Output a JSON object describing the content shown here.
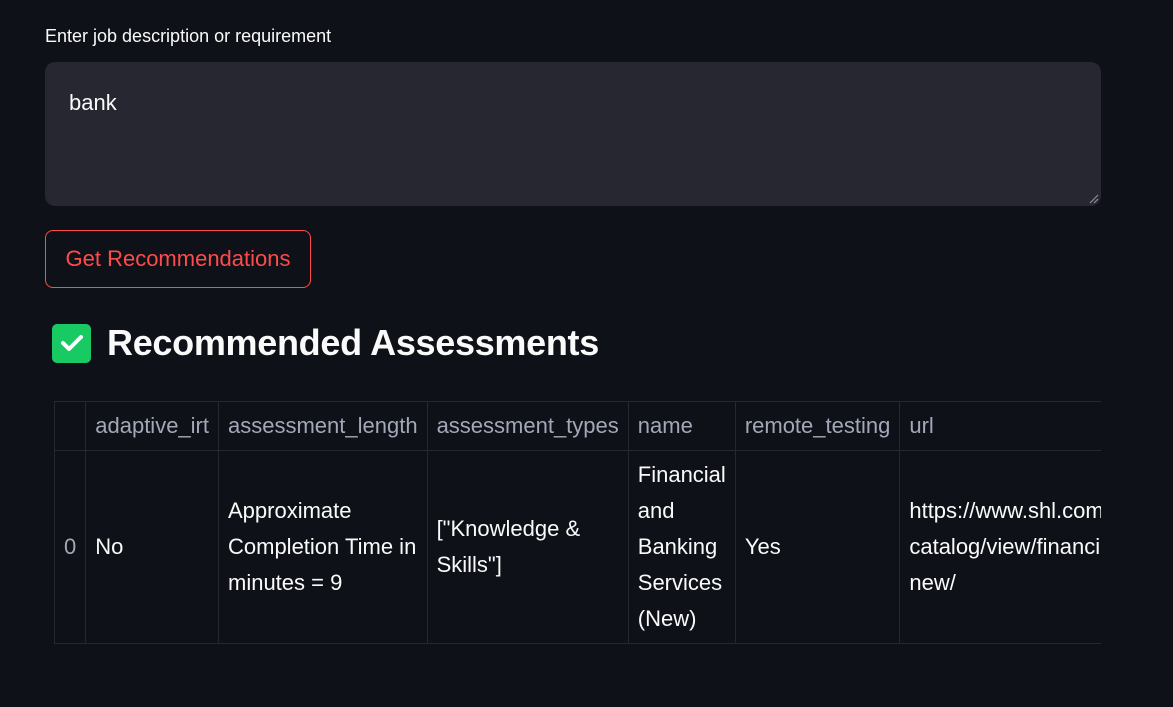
{
  "input": {
    "label": "Enter job description or requirement",
    "value": "bank"
  },
  "button": {
    "label": "Get Recommendations"
  },
  "results": {
    "heading": "Recommended Assessments",
    "columns": [
      "",
      "adaptive_irt",
      "assessment_length",
      "assessment_types",
      "name",
      "remote_testing",
      "url"
    ],
    "rows": [
      {
        "index": "0",
        "adaptive_irt": "No",
        "assessment_length": "Approximate Completion Time in minutes = 9",
        "assessment_types": "[\"Knowledge & Skills\"]",
        "name": "Financial and Banking Services (New)",
        "remote_testing": "Yes",
        "url_line1": "https://www.shl.com/solutions/products/product-",
        "url_line2": "catalog/view/financial-and-banking-services-",
        "url_line3": "new/"
      }
    ]
  },
  "colors": {
    "background": "#0e1117",
    "input_bg": "#262730",
    "accent": "#ff4b4b",
    "check": "#18c964"
  }
}
